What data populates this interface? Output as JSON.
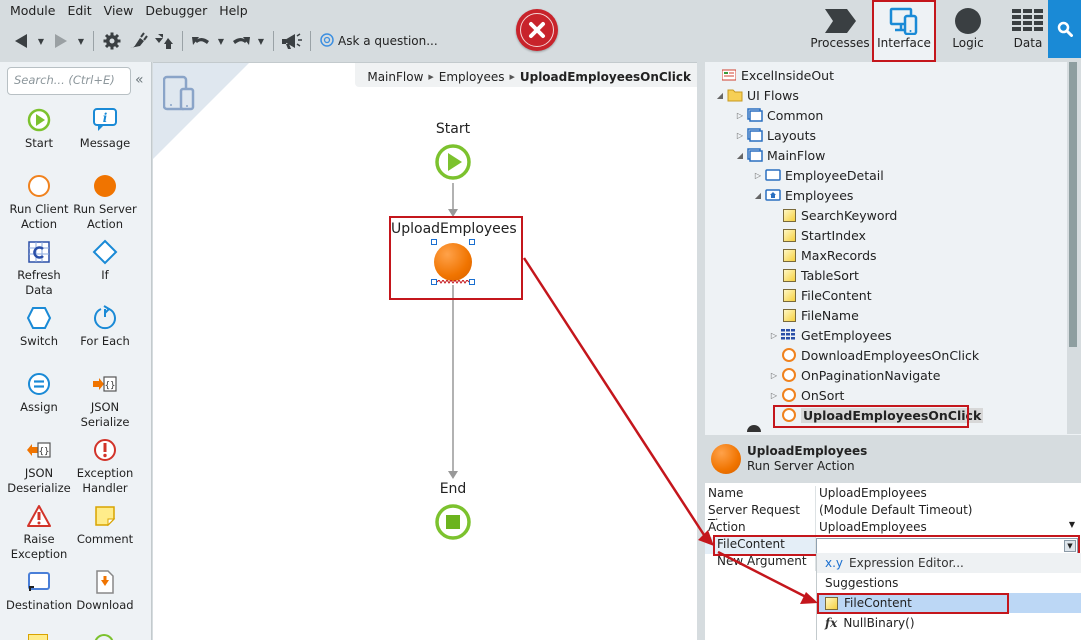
{
  "menu": [
    "Module",
    "Edit",
    "View",
    "Debugger",
    "Help"
  ],
  "toolbar": {
    "ask_label": "Ask a question...",
    "icons": [
      "back-icon",
      "forward-icon",
      "settings-icon",
      "connect-icon",
      "publish-icon",
      "undo-icon",
      "redo-icon",
      "announcement-icon"
    ]
  },
  "nav_tabs": [
    {
      "label": "Processes",
      "icon": "processes-icon",
      "active": false
    },
    {
      "label": "Interface",
      "icon": "interface-icon",
      "active": true
    },
    {
      "label": "Logic",
      "icon": "logic-icon",
      "active": false
    },
    {
      "label": "Data",
      "icon": "data-icon",
      "active": false
    }
  ],
  "toolbox": {
    "search_placeholder": "Search... (Ctrl+E)",
    "tools": [
      {
        "label1": "Start",
        "label2": "",
        "icon": "start-icon"
      },
      {
        "label1": "Message",
        "label2": "",
        "icon": "message-icon"
      },
      {
        "label1": "Run Client",
        "label2": "Action",
        "icon": "run-client-action-icon"
      },
      {
        "label1": "Run Server",
        "label2": "Action",
        "icon": "run-server-action-icon"
      },
      {
        "label1": "Refresh",
        "label2": "Data",
        "icon": "refresh-data-icon"
      },
      {
        "label1": "If",
        "label2": "",
        "icon": "if-icon"
      },
      {
        "label1": "Switch",
        "label2": "",
        "icon": "switch-icon"
      },
      {
        "label1": "For Each",
        "label2": "",
        "icon": "for-each-icon"
      },
      {
        "label1": "Assign",
        "label2": "",
        "icon": "assign-icon"
      },
      {
        "label1": "JSON",
        "label2": "Serialize",
        "icon": "json-serialize-icon"
      },
      {
        "label1": "JSON",
        "label2": "Deserialize",
        "icon": "json-deserialize-icon"
      },
      {
        "label1": "Exception",
        "label2": "Handler",
        "icon": "exception-handler-icon"
      },
      {
        "label1": "Raise",
        "label2": "Exception",
        "icon": "raise-exception-icon"
      },
      {
        "label1": "Comment",
        "label2": "",
        "icon": "comment-icon"
      },
      {
        "label1": "Destination",
        "label2": "",
        "icon": "destination-icon"
      },
      {
        "label1": "Download",
        "label2": "",
        "icon": "download-icon"
      }
    ]
  },
  "canvas": {
    "breadcrumb": [
      "MainFlow",
      "Employees",
      "UploadEmployeesOnClick"
    ],
    "nodes": {
      "start": "Start",
      "action": "UploadEmployees",
      "end": "End"
    }
  },
  "tree": [
    {
      "label": "ExcelInsideOut",
      "level": 0,
      "expander": "",
      "icon": "module-icon"
    },
    {
      "label": "UI Flows",
      "level": 1,
      "expander": "expanded",
      "icon": "folder-icon"
    },
    {
      "label": "Common",
      "level": 2,
      "expander": "collapsed",
      "icon": "ui-flow-icon"
    },
    {
      "label": "Layouts",
      "level": 2,
      "expander": "collapsed",
      "icon": "ui-flow-icon"
    },
    {
      "label": "MainFlow",
      "level": 2,
      "expander": "expanded",
      "icon": "ui-flow-icon"
    },
    {
      "label": "EmployeeDetail",
      "level": 3,
      "expander": "collapsed",
      "icon": "screen-icon"
    },
    {
      "label": "Employees",
      "level": 3,
      "expander": "expanded",
      "icon": "home-screen-icon"
    },
    {
      "label": "SearchKeyword",
      "level": 4,
      "expander": "",
      "icon": "variable-icon"
    },
    {
      "label": "StartIndex",
      "level": 4,
      "expander": "",
      "icon": "variable-icon"
    },
    {
      "label": "MaxRecords",
      "level": 4,
      "expander": "",
      "icon": "variable-icon"
    },
    {
      "label": "TableSort",
      "level": 4,
      "expander": "",
      "icon": "variable-icon"
    },
    {
      "label": "FileContent",
      "level": 4,
      "expander": "",
      "icon": "variable-icon"
    },
    {
      "label": "FileName",
      "level": 4,
      "expander": "",
      "icon": "variable-icon"
    },
    {
      "label": "GetEmployees",
      "level": 4,
      "expander": "collapsed",
      "icon": "aggregate-icon"
    },
    {
      "label": "DownloadEmployeesOnClick",
      "level": 4,
      "expander": "",
      "icon": "client-action-icon"
    },
    {
      "label": "OnPaginationNavigate",
      "level": 4,
      "expander": "collapsed",
      "icon": "client-action-icon"
    },
    {
      "label": "OnSort",
      "level": 4,
      "expander": "collapsed",
      "icon": "client-action-icon"
    },
    {
      "label": "UploadEmployeesOnClick",
      "level": 4,
      "expander": "",
      "icon": "client-action-icon",
      "selected": true
    }
  ],
  "properties": {
    "title": "UploadEmployees",
    "subtitle": "Run Server Action",
    "rows": [
      {
        "key": "Name",
        "value": "UploadEmployees"
      },
      {
        "key": "Server Request Ti...",
        "value": "(Module Default Timeout)"
      },
      {
        "key": "Action",
        "value": "UploadEmployees"
      }
    ],
    "argument": {
      "key": "FileContent",
      "value": ""
    },
    "new_argument": "New Argument",
    "dropdown": {
      "expression_editor": "Expression Editor...",
      "expression_icon": "x.y",
      "suggestions_header": "Suggestions",
      "items": [
        {
          "label": "FileContent",
          "icon": "variable-icon",
          "highlighted": true
        },
        {
          "label": "NullBinary()",
          "icon": "function-icon",
          "highlighted": false
        }
      ]
    }
  },
  "colors": {
    "accent": "#1a8ad6",
    "highlight_box": "#c4161c",
    "server_action": "#f07400",
    "start_end": "#7cc22e"
  }
}
